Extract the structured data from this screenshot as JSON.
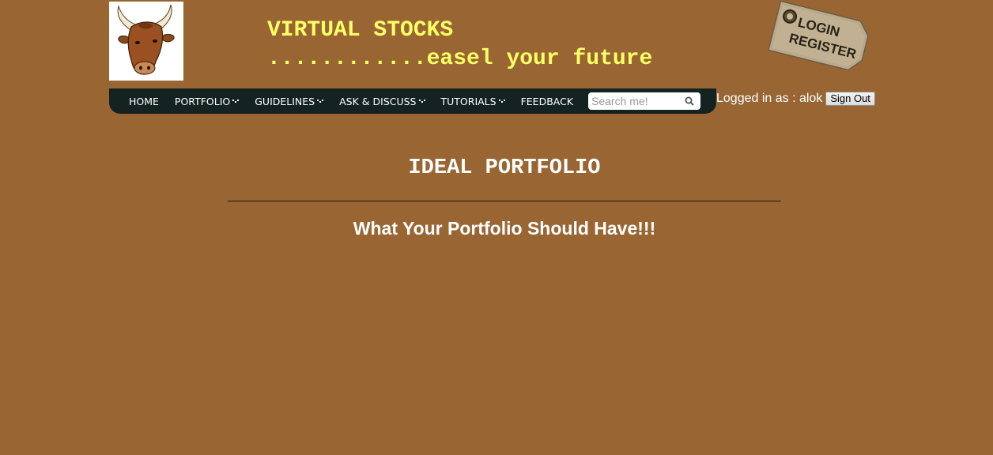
{
  "header": {
    "title": "VIRTUAL STOCKS",
    "tagline": "............easel your future",
    "logo_icon": "bull-head-icon",
    "login_tag": {
      "line1": "LOGIN",
      "line2": "REGISTER"
    }
  },
  "nav": {
    "items": [
      {
        "label": "HOME",
        "dropdown": false
      },
      {
        "label": "PORTFOLIO",
        "dropdown": true
      },
      {
        "label": "GUIDELINES",
        "dropdown": true
      },
      {
        "label": "ASK & DISCUSS",
        "dropdown": true
      },
      {
        "label": "TUTORIALS",
        "dropdown": true
      },
      {
        "label": "FEEDBACK",
        "dropdown": false
      }
    ],
    "search": {
      "placeholder": "Search me!",
      "value": ""
    }
  },
  "user": {
    "logged_in_text": "Logged in as : alok",
    "signout_label": "Sign Out"
  },
  "main": {
    "heading": "IDEAL PORTFOLIO",
    "subheading": "What Your Portfolio Should Have!!!"
  },
  "colors": {
    "background": "#996633",
    "title": "#ffff66",
    "navbar": "#142222",
    "text": "#ffffff"
  }
}
